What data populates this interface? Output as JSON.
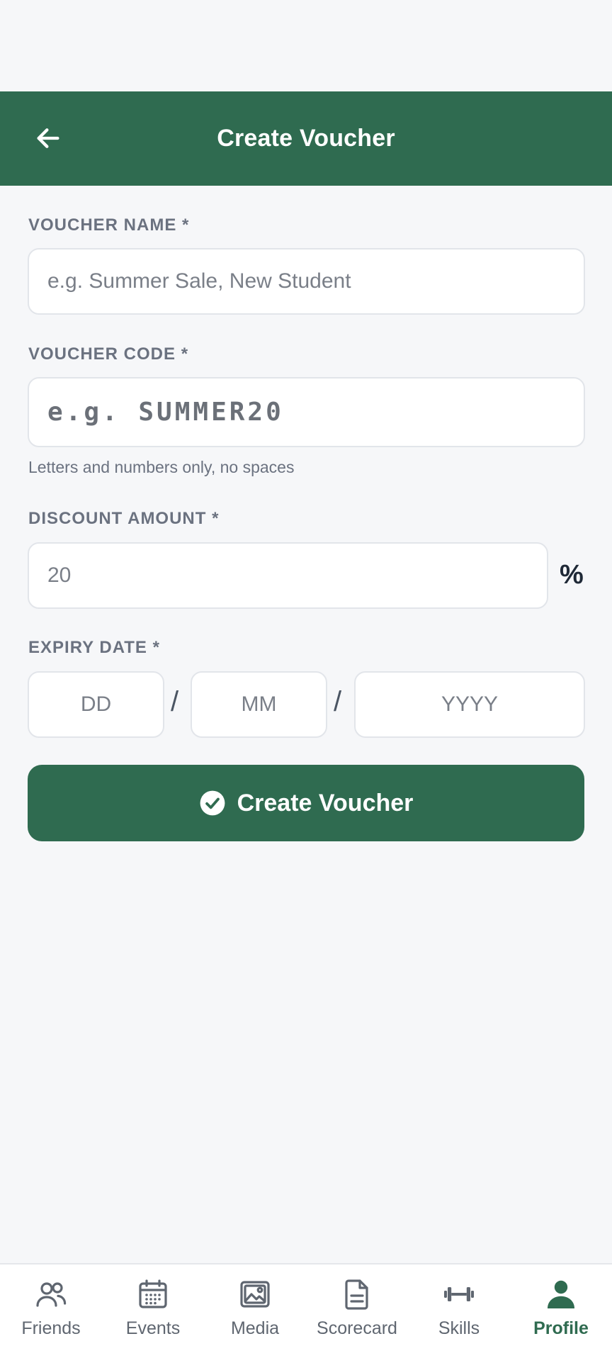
{
  "header": {
    "title": "Create Voucher"
  },
  "form": {
    "voucher_name": {
      "label": "VOUCHER NAME *",
      "placeholder": "e.g. Summer Sale, New Student",
      "value": ""
    },
    "voucher_code": {
      "label": "VOUCHER CODE *",
      "placeholder": "e.g. SUMMER20",
      "value": "",
      "helper": "Letters and numbers only, no spaces"
    },
    "discount": {
      "label": "DISCOUNT AMOUNT *",
      "placeholder": "20",
      "value": "",
      "suffix": "%"
    },
    "expiry": {
      "label": "EXPIRY DATE *",
      "day_placeholder": "DD",
      "month_placeholder": "MM",
      "year_placeholder": "YYYY",
      "separator": "/"
    },
    "submit_label": "Create Voucher"
  },
  "nav": {
    "items": [
      {
        "label": "Friends",
        "icon": "friends-icon",
        "active": false
      },
      {
        "label": "Events",
        "icon": "calendar-icon",
        "active": false
      },
      {
        "label": "Media",
        "icon": "image-icon",
        "active": false
      },
      {
        "label": "Scorecard",
        "icon": "document-icon",
        "active": false
      },
      {
        "label": "Skills",
        "icon": "dumbbell-icon",
        "active": false
      },
      {
        "label": "Profile",
        "icon": "person-icon",
        "active": true
      }
    ]
  },
  "colors": {
    "primary": "#2f6b50",
    "background": "#f6f7f9",
    "label": "#6b7280",
    "inactive_nav": "#5f6670"
  }
}
